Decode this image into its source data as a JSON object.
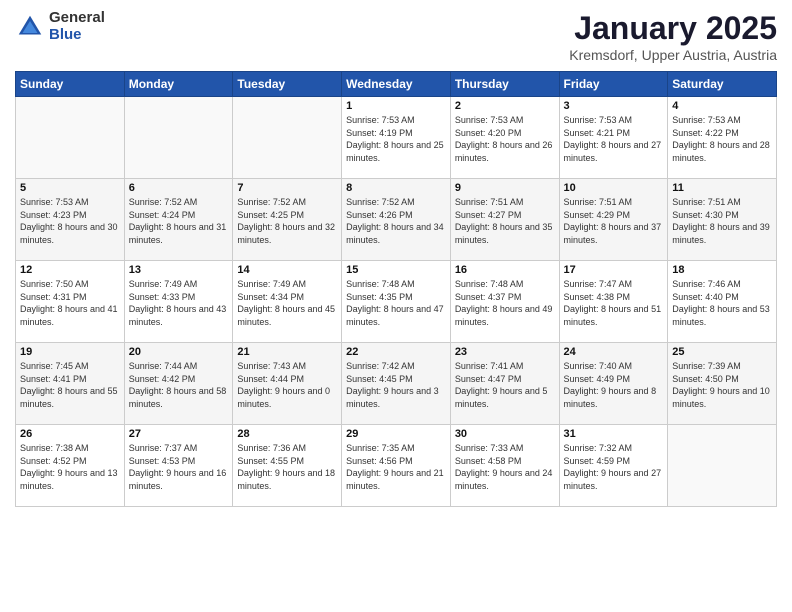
{
  "logo": {
    "general": "General",
    "blue": "Blue"
  },
  "header": {
    "title": "January 2025",
    "subtitle": "Kremsdorf, Upper Austria, Austria"
  },
  "days": [
    "Sunday",
    "Monday",
    "Tuesday",
    "Wednesday",
    "Thursday",
    "Friday",
    "Saturday"
  ],
  "weeks": [
    [
      {
        "day": "",
        "detail": ""
      },
      {
        "day": "",
        "detail": ""
      },
      {
        "day": "",
        "detail": ""
      },
      {
        "day": "1",
        "detail": "Sunrise: 7:53 AM\nSunset: 4:19 PM\nDaylight: 8 hours\nand 25 minutes."
      },
      {
        "day": "2",
        "detail": "Sunrise: 7:53 AM\nSunset: 4:20 PM\nDaylight: 8 hours\nand 26 minutes."
      },
      {
        "day": "3",
        "detail": "Sunrise: 7:53 AM\nSunset: 4:21 PM\nDaylight: 8 hours\nand 27 minutes."
      },
      {
        "day": "4",
        "detail": "Sunrise: 7:53 AM\nSunset: 4:22 PM\nDaylight: 8 hours\nand 28 minutes."
      }
    ],
    [
      {
        "day": "5",
        "detail": "Sunrise: 7:53 AM\nSunset: 4:23 PM\nDaylight: 8 hours\nand 30 minutes."
      },
      {
        "day": "6",
        "detail": "Sunrise: 7:52 AM\nSunset: 4:24 PM\nDaylight: 8 hours\nand 31 minutes."
      },
      {
        "day": "7",
        "detail": "Sunrise: 7:52 AM\nSunset: 4:25 PM\nDaylight: 8 hours\nand 32 minutes."
      },
      {
        "day": "8",
        "detail": "Sunrise: 7:52 AM\nSunset: 4:26 PM\nDaylight: 8 hours\nand 34 minutes."
      },
      {
        "day": "9",
        "detail": "Sunrise: 7:51 AM\nSunset: 4:27 PM\nDaylight: 8 hours\nand 35 minutes."
      },
      {
        "day": "10",
        "detail": "Sunrise: 7:51 AM\nSunset: 4:29 PM\nDaylight: 8 hours\nand 37 minutes."
      },
      {
        "day": "11",
        "detail": "Sunrise: 7:51 AM\nSunset: 4:30 PM\nDaylight: 8 hours\nand 39 minutes."
      }
    ],
    [
      {
        "day": "12",
        "detail": "Sunrise: 7:50 AM\nSunset: 4:31 PM\nDaylight: 8 hours\nand 41 minutes."
      },
      {
        "day": "13",
        "detail": "Sunrise: 7:49 AM\nSunset: 4:33 PM\nDaylight: 8 hours\nand 43 minutes."
      },
      {
        "day": "14",
        "detail": "Sunrise: 7:49 AM\nSunset: 4:34 PM\nDaylight: 8 hours\nand 45 minutes."
      },
      {
        "day": "15",
        "detail": "Sunrise: 7:48 AM\nSunset: 4:35 PM\nDaylight: 8 hours\nand 47 minutes."
      },
      {
        "day": "16",
        "detail": "Sunrise: 7:48 AM\nSunset: 4:37 PM\nDaylight: 8 hours\nand 49 minutes."
      },
      {
        "day": "17",
        "detail": "Sunrise: 7:47 AM\nSunset: 4:38 PM\nDaylight: 8 hours\nand 51 minutes."
      },
      {
        "day": "18",
        "detail": "Sunrise: 7:46 AM\nSunset: 4:40 PM\nDaylight: 8 hours\nand 53 minutes."
      }
    ],
    [
      {
        "day": "19",
        "detail": "Sunrise: 7:45 AM\nSunset: 4:41 PM\nDaylight: 8 hours\nand 55 minutes."
      },
      {
        "day": "20",
        "detail": "Sunrise: 7:44 AM\nSunset: 4:42 PM\nDaylight: 8 hours\nand 58 minutes."
      },
      {
        "day": "21",
        "detail": "Sunrise: 7:43 AM\nSunset: 4:44 PM\nDaylight: 9 hours\nand 0 minutes."
      },
      {
        "day": "22",
        "detail": "Sunrise: 7:42 AM\nSunset: 4:45 PM\nDaylight: 9 hours\nand 3 minutes."
      },
      {
        "day": "23",
        "detail": "Sunrise: 7:41 AM\nSunset: 4:47 PM\nDaylight: 9 hours\nand 5 minutes."
      },
      {
        "day": "24",
        "detail": "Sunrise: 7:40 AM\nSunset: 4:49 PM\nDaylight: 9 hours\nand 8 minutes."
      },
      {
        "day": "25",
        "detail": "Sunrise: 7:39 AM\nSunset: 4:50 PM\nDaylight: 9 hours\nand 10 minutes."
      }
    ],
    [
      {
        "day": "26",
        "detail": "Sunrise: 7:38 AM\nSunset: 4:52 PM\nDaylight: 9 hours\nand 13 minutes."
      },
      {
        "day": "27",
        "detail": "Sunrise: 7:37 AM\nSunset: 4:53 PM\nDaylight: 9 hours\nand 16 minutes."
      },
      {
        "day": "28",
        "detail": "Sunrise: 7:36 AM\nSunset: 4:55 PM\nDaylight: 9 hours\nand 18 minutes."
      },
      {
        "day": "29",
        "detail": "Sunrise: 7:35 AM\nSunset: 4:56 PM\nDaylight: 9 hours\nand 21 minutes."
      },
      {
        "day": "30",
        "detail": "Sunrise: 7:33 AM\nSunset: 4:58 PM\nDaylight: 9 hours\nand 24 minutes."
      },
      {
        "day": "31",
        "detail": "Sunrise: 7:32 AM\nSunset: 4:59 PM\nDaylight: 9 hours\nand 27 minutes."
      },
      {
        "day": "",
        "detail": ""
      }
    ]
  ]
}
